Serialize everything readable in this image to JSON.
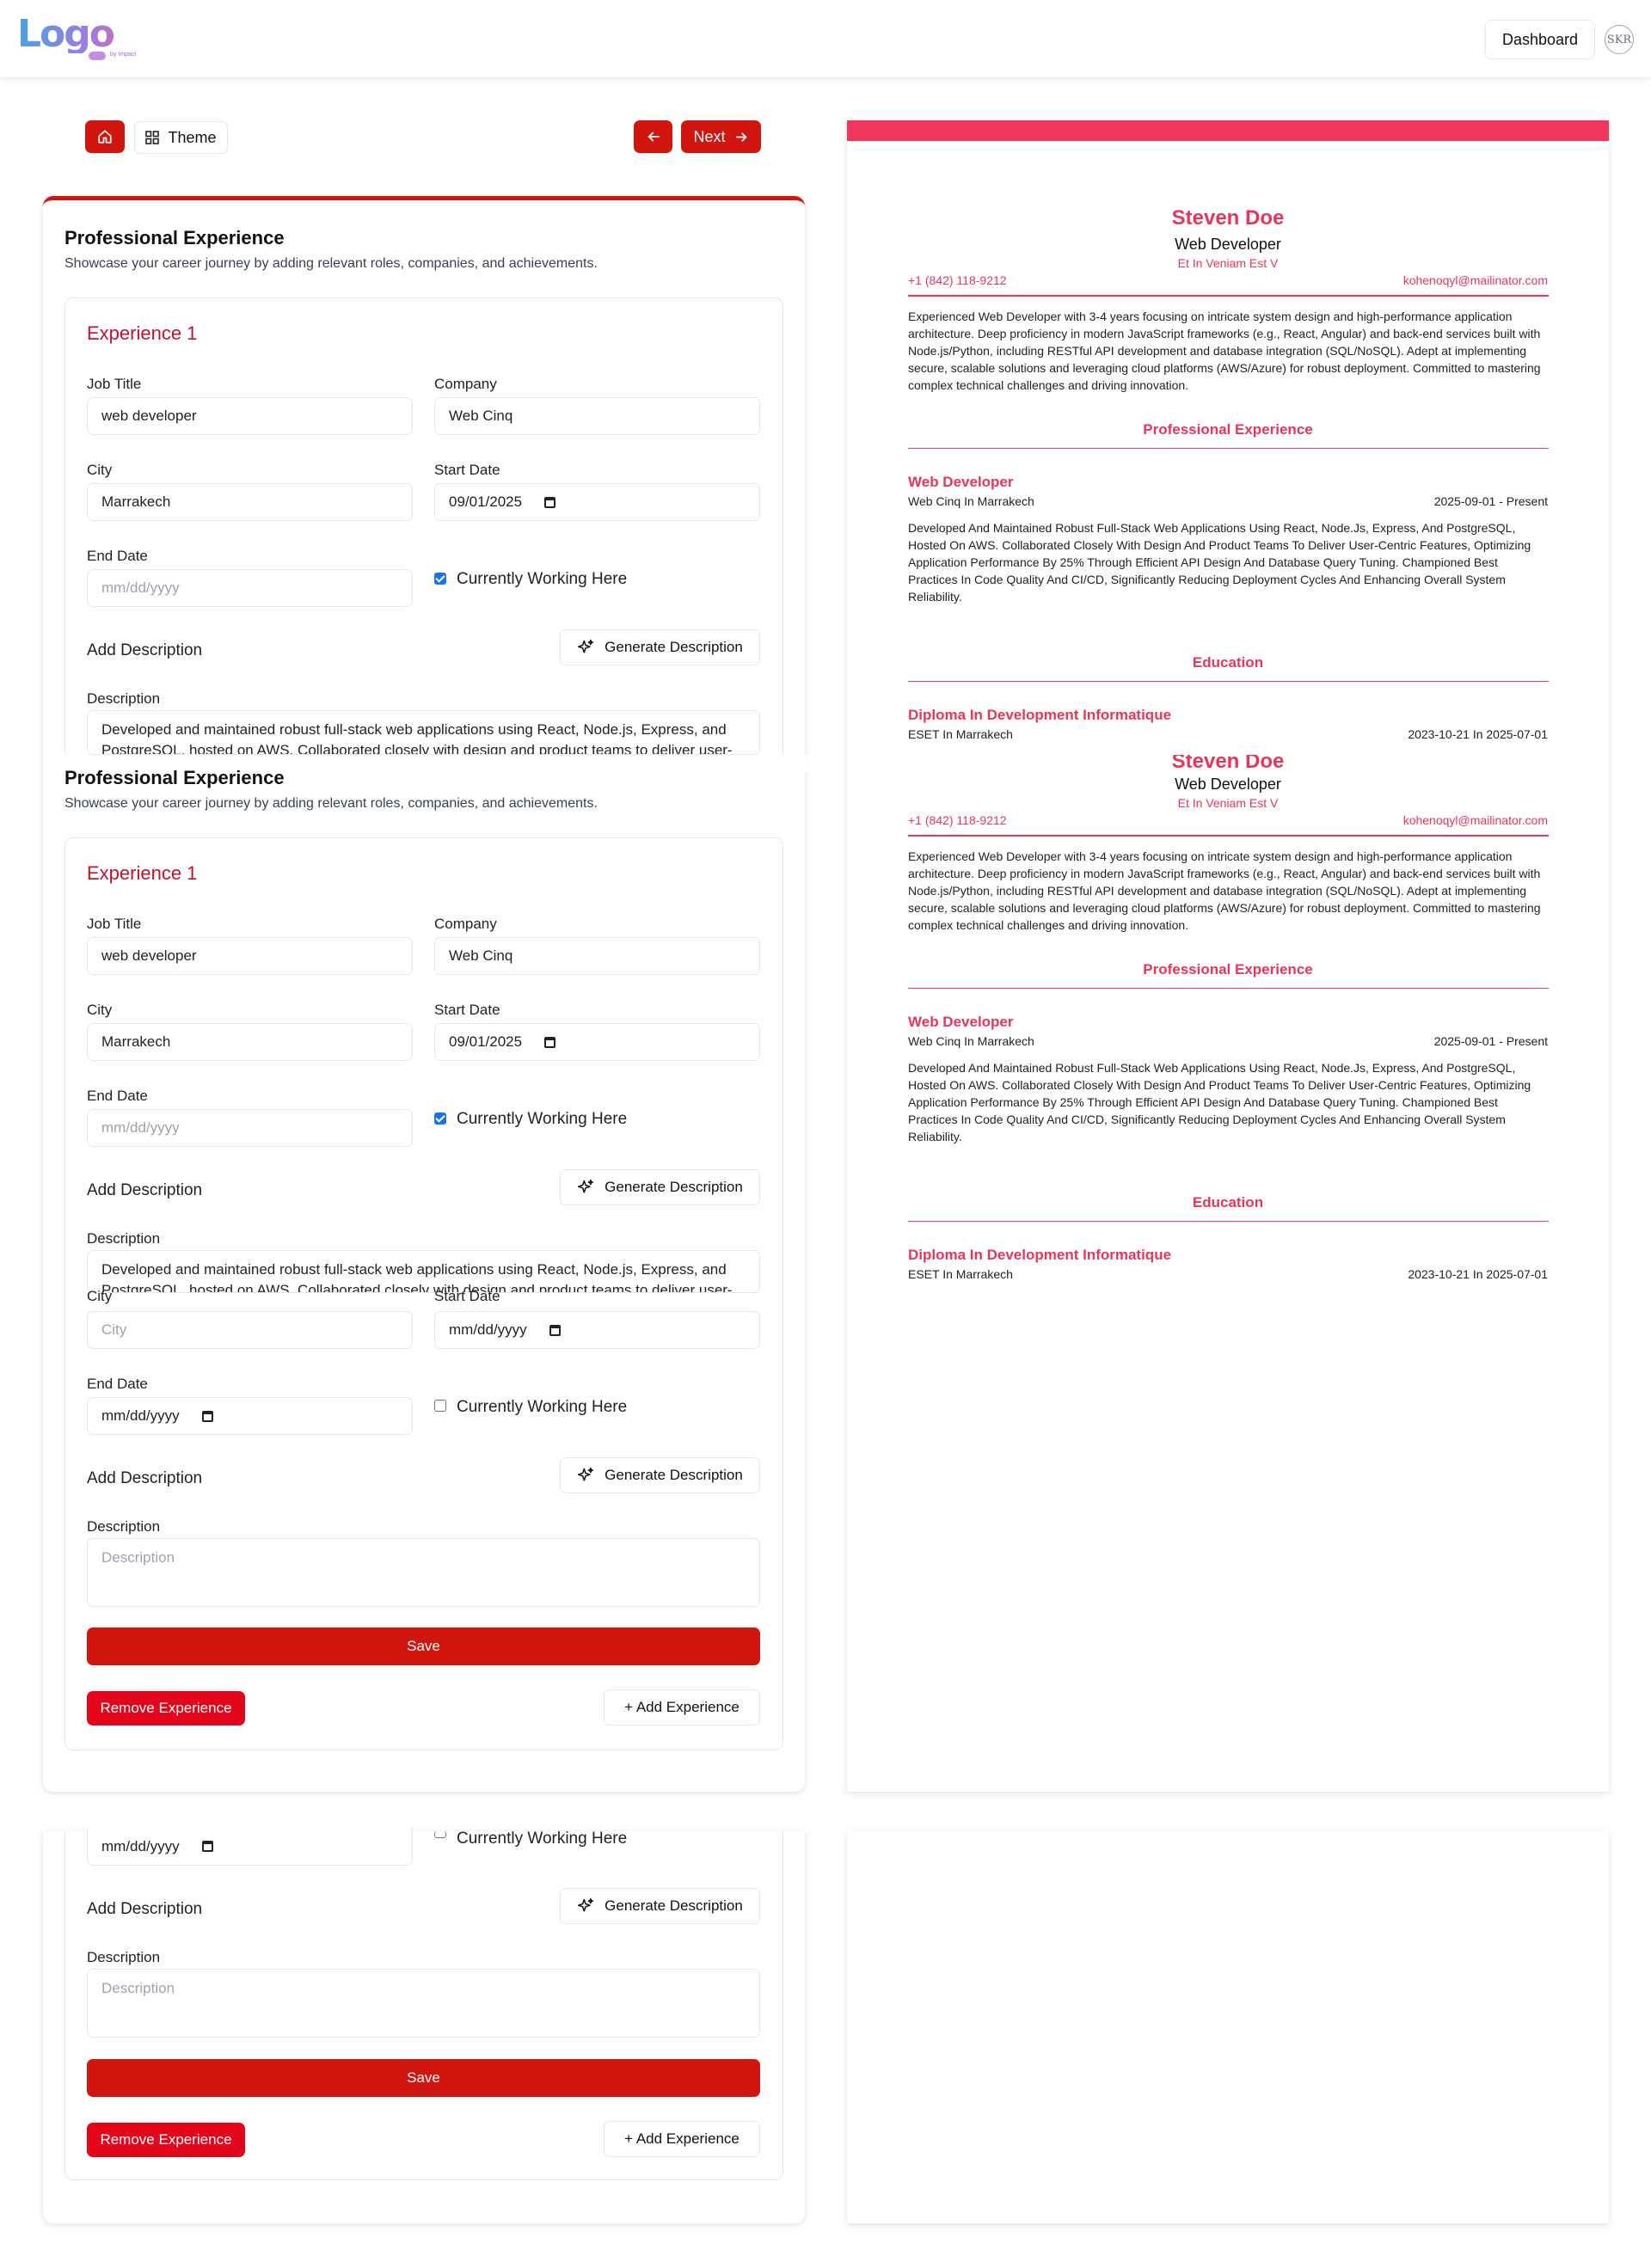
{
  "header": {
    "logo_text": "Logo",
    "logo_tagline": "by Impact",
    "dashboard_label": "Dashboard",
    "avatar_initials": "SKR"
  },
  "toolbar": {
    "theme_label": "Theme",
    "next_label": "Next"
  },
  "form": {
    "section_title": "Professional Experience",
    "section_subtitle": "Showcase your career journey by adding relevant roles, companies, and achievements.",
    "experience_title": "Experience 1",
    "labels": {
      "job_title": "Job Title",
      "company": "Company",
      "city": "City",
      "start_date": "Start Date",
      "end_date": "End Date",
      "currently_working": "Currently Working Here",
      "add_description": "Add Description",
      "generate_description": "Generate Description",
      "description": "Description",
      "save": "Save",
      "remove_experience": "Remove Experience",
      "add_experience": "+ Add Experience"
    },
    "experience_1": {
      "job_title": "web developer",
      "company": "Web Cinq",
      "city": "Marrakech",
      "start_date": "09/01/2025",
      "end_date_placeholder": "mm/dd/yyyy",
      "currently_working": true,
      "description": "Developed and maintained robust full-stack web applications using React, Node.js, Express, and PostgreSQL, hosted on AWS. Collaborated closely with design and product teams to deliver user-"
    },
    "experience_2": {
      "city_placeholder": "City",
      "start_date_placeholder": "mm/dd/yyyy",
      "end_date_placeholder": "mm/dd/yyyy",
      "currently_working": false,
      "description_placeholder": "Description"
    }
  },
  "resume": {
    "name": "Steven Doe",
    "role": "Web Developer",
    "location": "Et In Veniam Est V",
    "phone": "+1 (842) 118-9212",
    "email": "kohenoqyl@mailinator.com",
    "summary": "Experienced Web Developer with 3-4 years focusing on intricate system design and high-performance application architecture. Deep proficiency in modern JavaScript frameworks (e.g., React, Angular) and back-end services built with Node.js/Python, including RESTful API development and database integration (SQL/NoSQL). Adept at implementing secure, scalable solutions and leveraging cloud platforms (AWS/Azure) for robust deployment. Committed to mastering complex technical challenges and driving innovation.",
    "experience_heading": "Professional Experience",
    "job_title": "Web Developer",
    "job_company": "Web Cinq In Marrakech",
    "job_dates": "2025-09-01 - Present",
    "job_description": "Developed And Maintained Robust Full-Stack Web Applications Using React, Node.Js, Express, And PostgreSQL, Hosted On AWS. Collaborated Closely With Design And Product Teams To Deliver User-Centric Features, Optimizing Application Performance By 25% Through Efficient API Design And Database Query Tuning. Championed Best Practices In Code Quality And CI/CD, Significantly Reducing Deployment Cycles And Enhancing Overall System Reliability.",
    "education_heading": "Education",
    "edu_title": "Diploma In Development Informatique",
    "edu_school": "ESET In Marrakech",
    "edu_dates": "2023-10-21 In 2025-07-01"
  },
  "colors": {
    "primary_red": "#d0160f",
    "resume_accent": "#e8365a",
    "checkbox_blue": "#1a73e8"
  },
  "icons": [
    "home-icon",
    "grid-icon",
    "arrow-left-icon",
    "arrow-right-icon",
    "sparkle-icon",
    "calendar-icon"
  ]
}
